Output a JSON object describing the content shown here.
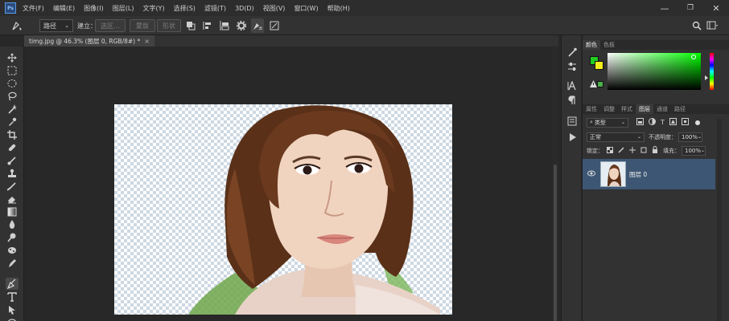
{
  "app": {
    "logo": "Ps"
  },
  "menu": [
    "文件(F)",
    "编辑(E)",
    "图像(I)",
    "图层(L)",
    "文字(Y)",
    "选择(S)",
    "滤镜(T)",
    "3D(D)",
    "视图(V)",
    "窗口(W)",
    "帮助(H)"
  ],
  "window_controls": {
    "minimize": "—",
    "restore": "❐",
    "close": "✕"
  },
  "options_bar": {
    "mode_select": "路径",
    "build_label": "建立：",
    "selection_btn": "选区…",
    "mask_btn": "蒙版",
    "shape_btn": "形状"
  },
  "document": {
    "tab_title": "timg.jpg @ 46.3% (图层 0, RGB/8#) *",
    "close_glyph": "×"
  },
  "color_panel": {
    "tabs": [
      "颜色",
      "色板"
    ],
    "foreground": "#22cc22",
    "background": "#f2ee1a",
    "web_safe": "#4cb04c"
  },
  "layers_panel": {
    "tabs": [
      "属性",
      "调整",
      "样式",
      "图层",
      "通道",
      "路径"
    ],
    "active_tab": "图层",
    "filter_kind": "类型",
    "blend_mode": "正常",
    "opacity_label": "不透明度：",
    "opacity": "100%",
    "lock_label": "锁定：",
    "fill_label": "填充：",
    "fill": "100%",
    "layers": [
      {
        "name": "图层 0",
        "visible": true
      }
    ]
  }
}
